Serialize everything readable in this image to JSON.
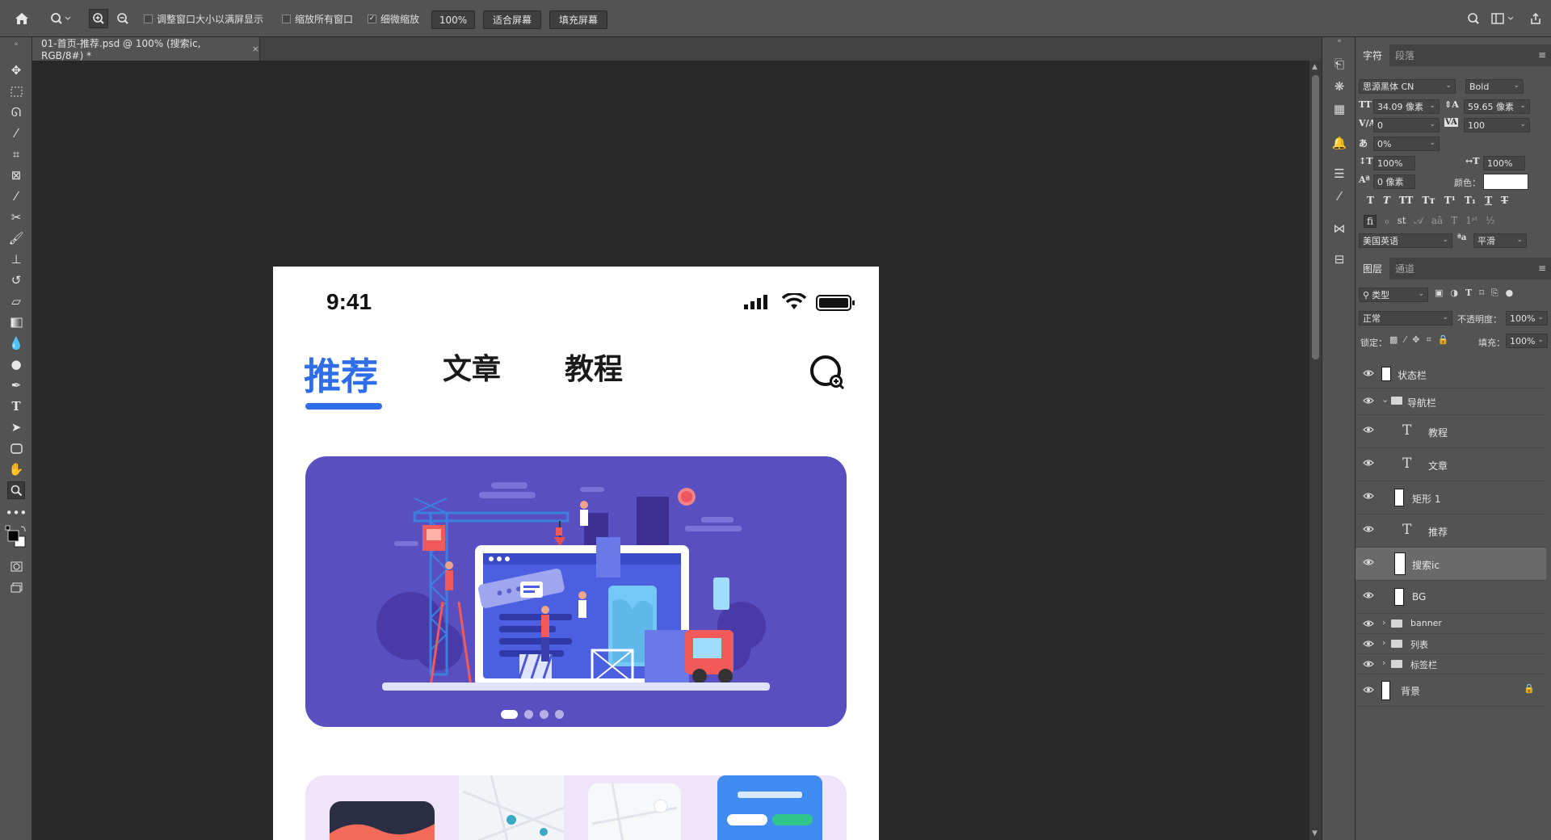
{
  "options_bar": {
    "zoom_options": {
      "resize_windows": "调整窗口大小以满屏显示",
      "zoom_all_windows": "缩放所有窗口",
      "scrubby_zoom": "细微缩放"
    },
    "zoom_value": "100%",
    "fit_screen": "适合屏幕",
    "fill_screen": "填充屏幕"
  },
  "document_tab": {
    "title": "01-首页-推荐.psd @ 100% (搜索ic, RGB/8#) *",
    "close": "×"
  },
  "artboard": {
    "status_time": "9:41",
    "tabs": [
      {
        "label": "推荐"
      },
      {
        "label": "文章"
      },
      {
        "label": "教程"
      }
    ],
    "banner_dots": 4
  },
  "character_panel": {
    "tabs": [
      "字符",
      "段落"
    ],
    "font_family": "思源黑体 CN",
    "font_style": "Bold",
    "font_size": "34.09 像素",
    "leading": "59.65 像素",
    "kerning": "0",
    "tracking": "100",
    "tsume": "0%",
    "vertical_scale": "100%",
    "horizontal_scale": "100%",
    "baseline_shift": "0 像素",
    "color_label": "颜色：",
    "language": "美国英语",
    "antialias": "平滑",
    "colors": {
      "text_color": "#ffffff"
    }
  },
  "layers_panel": {
    "tabs": [
      "图层",
      "通道"
    ],
    "filter_kind": "类型",
    "blend_mode": "正常",
    "opacity_label": "不透明度：",
    "opacity": "100%",
    "lock_label": "锁定：",
    "fill_label": "填充：",
    "fill": "100%",
    "layers": [
      {
        "name": "状态栏",
        "kind": "smart"
      },
      {
        "name": "导航栏",
        "kind": "group-open"
      },
      {
        "name": "教程",
        "kind": "text"
      },
      {
        "name": "文章",
        "kind": "text"
      },
      {
        "name": "矩形 1",
        "kind": "shape"
      },
      {
        "name": "推荐",
        "kind": "text"
      },
      {
        "name": "搜索ic",
        "kind": "smart",
        "selected": true
      },
      {
        "name": "BG",
        "kind": "shape"
      },
      {
        "name": "banner",
        "kind": "group"
      },
      {
        "name": "列表",
        "kind": "group"
      },
      {
        "name": "标签栏",
        "kind": "group"
      },
      {
        "name": "背景",
        "kind": "background"
      }
    ]
  },
  "colors": {
    "accent_blue": "#2f6ee8",
    "banner_purple": "#5a4fc1",
    "panel_bg": "#535353"
  }
}
